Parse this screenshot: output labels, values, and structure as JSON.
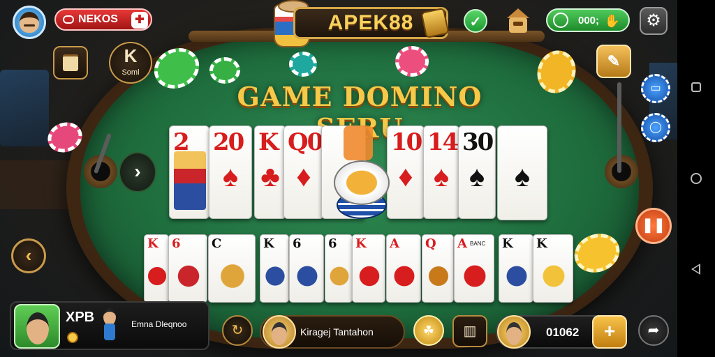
{
  "header": {
    "player_name": "NEKOS",
    "logo_text": "APEK88",
    "coin_balance": "000;"
  },
  "controls": {
    "k_button_label": "Soml",
    "nav_right_glyph": "›",
    "nav_left_glyph": "‹"
  },
  "table": {
    "title": "GAME DOMINO SERU",
    "top_cards": [
      {
        "rank": "2",
        "color": "red",
        "face": true
      },
      {
        "rank": "20",
        "color": "red",
        "suit": "♠"
      },
      {
        "rank": "K",
        "color": "red",
        "suit": "♣"
      },
      {
        "rank": "Q0",
        "color": "red",
        "suit": "♦"
      },
      {
        "rank": "",
        "color": "black",
        "suit": ""
      },
      {
        "rank": "10",
        "color": "red",
        "suit": "♦"
      },
      {
        "rank": "14",
        "color": "red",
        "suit": "♠"
      },
      {
        "rank": "30",
        "color": "black",
        "suit": "♠"
      },
      {
        "rank": "",
        "color": "black",
        "suit": "♠"
      }
    ],
    "bottom_cards": [
      {
        "rank": "K",
        "color": "red"
      },
      {
        "rank": "6",
        "color": "red"
      },
      {
        "rank": "C",
        "color": "black"
      },
      {
        "rank": "K",
        "color": "black"
      },
      {
        "rank": "6",
        "color": "black"
      },
      {
        "rank": "6",
        "color": "black"
      },
      {
        "rank": "K",
        "color": "red"
      },
      {
        "rank": "A",
        "color": "red"
      },
      {
        "rank": "Q",
        "color": "red"
      },
      {
        "rank": "A",
        "color": "red"
      },
      {
        "rank": "K",
        "color": "black"
      },
      {
        "rank": "K",
        "color": "black"
      }
    ],
    "bottom_card_label": "BANC"
  },
  "player": {
    "name": "XPB",
    "subtitle": "Emna Dleqnoo"
  },
  "opponent": {
    "name": "Kiragej Tantahon"
  },
  "balance": {
    "value": "01062",
    "plus": "+"
  },
  "colors": {
    "felt": "#1f6e3e",
    "accent_gold": "#f7c948",
    "accent_red": "#d71d1d"
  }
}
